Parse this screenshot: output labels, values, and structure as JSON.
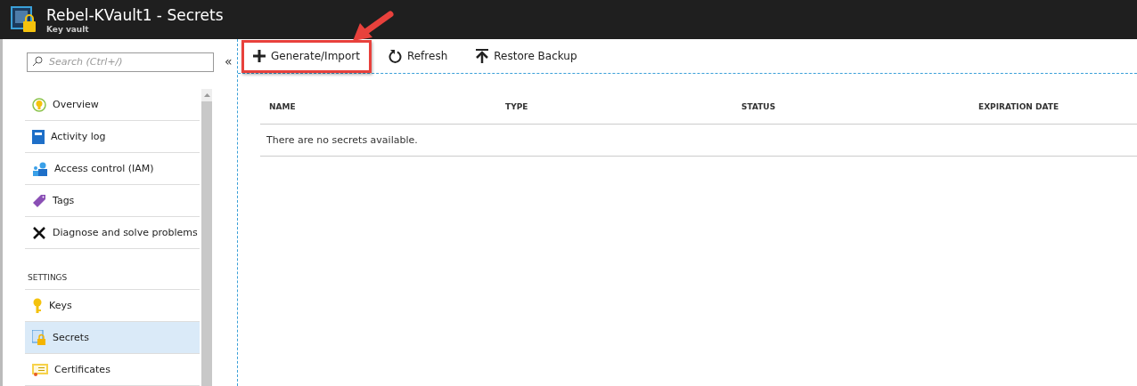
{
  "header": {
    "title": "Rebel-KVault1 - Secrets",
    "subtitle": "Key vault"
  },
  "sidebar": {
    "search": {
      "placeholder": "Search (Ctrl+/)"
    },
    "collapse": "«",
    "items": [
      {
        "kind": "item",
        "label": "Overview",
        "selected": false
      },
      {
        "kind": "item",
        "label": "Activity log",
        "selected": false
      },
      {
        "kind": "item",
        "label": "Access control (IAM)",
        "selected": false
      },
      {
        "kind": "item",
        "label": "Tags",
        "selected": false
      },
      {
        "kind": "item",
        "label": "Diagnose and solve problems",
        "selected": false
      },
      {
        "kind": "section",
        "label": "SETTINGS"
      },
      {
        "kind": "item",
        "label": "Keys",
        "selected": false
      },
      {
        "kind": "item",
        "label": "Secrets",
        "selected": true
      },
      {
        "kind": "item",
        "label": "Certificates",
        "selected": false
      }
    ]
  },
  "toolbar": [
    {
      "label": "Generate/Import",
      "annotated": true
    },
    {
      "label": "Refresh",
      "annotated": false
    },
    {
      "label": "Restore Backup",
      "annotated": false
    }
  ],
  "table": {
    "columns": [
      "NAME",
      "TYPE",
      "STATUS",
      "EXPIRATION DATE"
    ],
    "empty_message": "There are no secrets available."
  }
}
